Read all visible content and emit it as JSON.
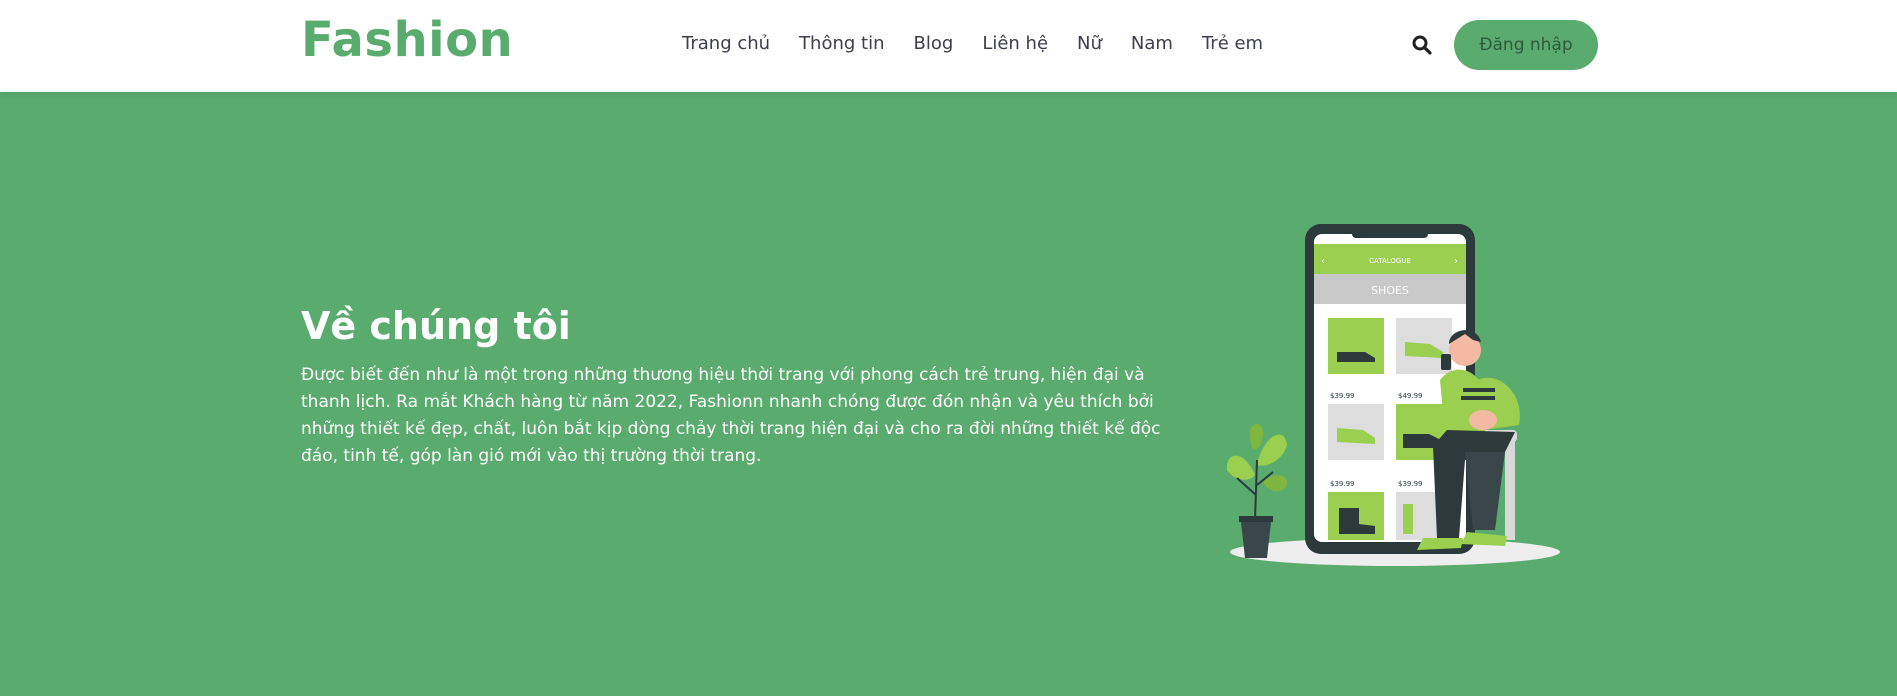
{
  "header": {
    "logo": "Fashion",
    "nav": [
      "Trang chủ",
      "Thông tin",
      "Blog",
      "Liên hệ",
      "Nữ",
      "Nam",
      "Trẻ em"
    ],
    "login_label": "Đăng nhập",
    "search_icon": "search-icon"
  },
  "hero": {
    "title": "Về chúng tôi",
    "paragraph": "Được biết đến như là một trong những thương hiệu thời trang với phong cách trẻ trung, hiện đại và thanh lịch. Ra mắt Khách hàng từ năm 2022, Fashionn nhanh chóng được đón nhận và yêu thích bởi những thiết kế đẹp, chất, luôn bắt kịp dòng chảy thời trang hiện đại và cho ra đời những thiết kế độc đáo, tinh tế, góp làn gió mới vào thị trường thời trang."
  },
  "illustration": {
    "phone_header": "CATALOGUE",
    "phone_category": "SHOES",
    "prices": [
      "$39.99",
      "$49.99",
      "$39.99",
      "$39.99"
    ]
  },
  "colors": {
    "brand_green": "#5aab6e",
    "lime": "#9bcf4f",
    "dark": "#2d3a3c",
    "white": "#ffffff"
  }
}
